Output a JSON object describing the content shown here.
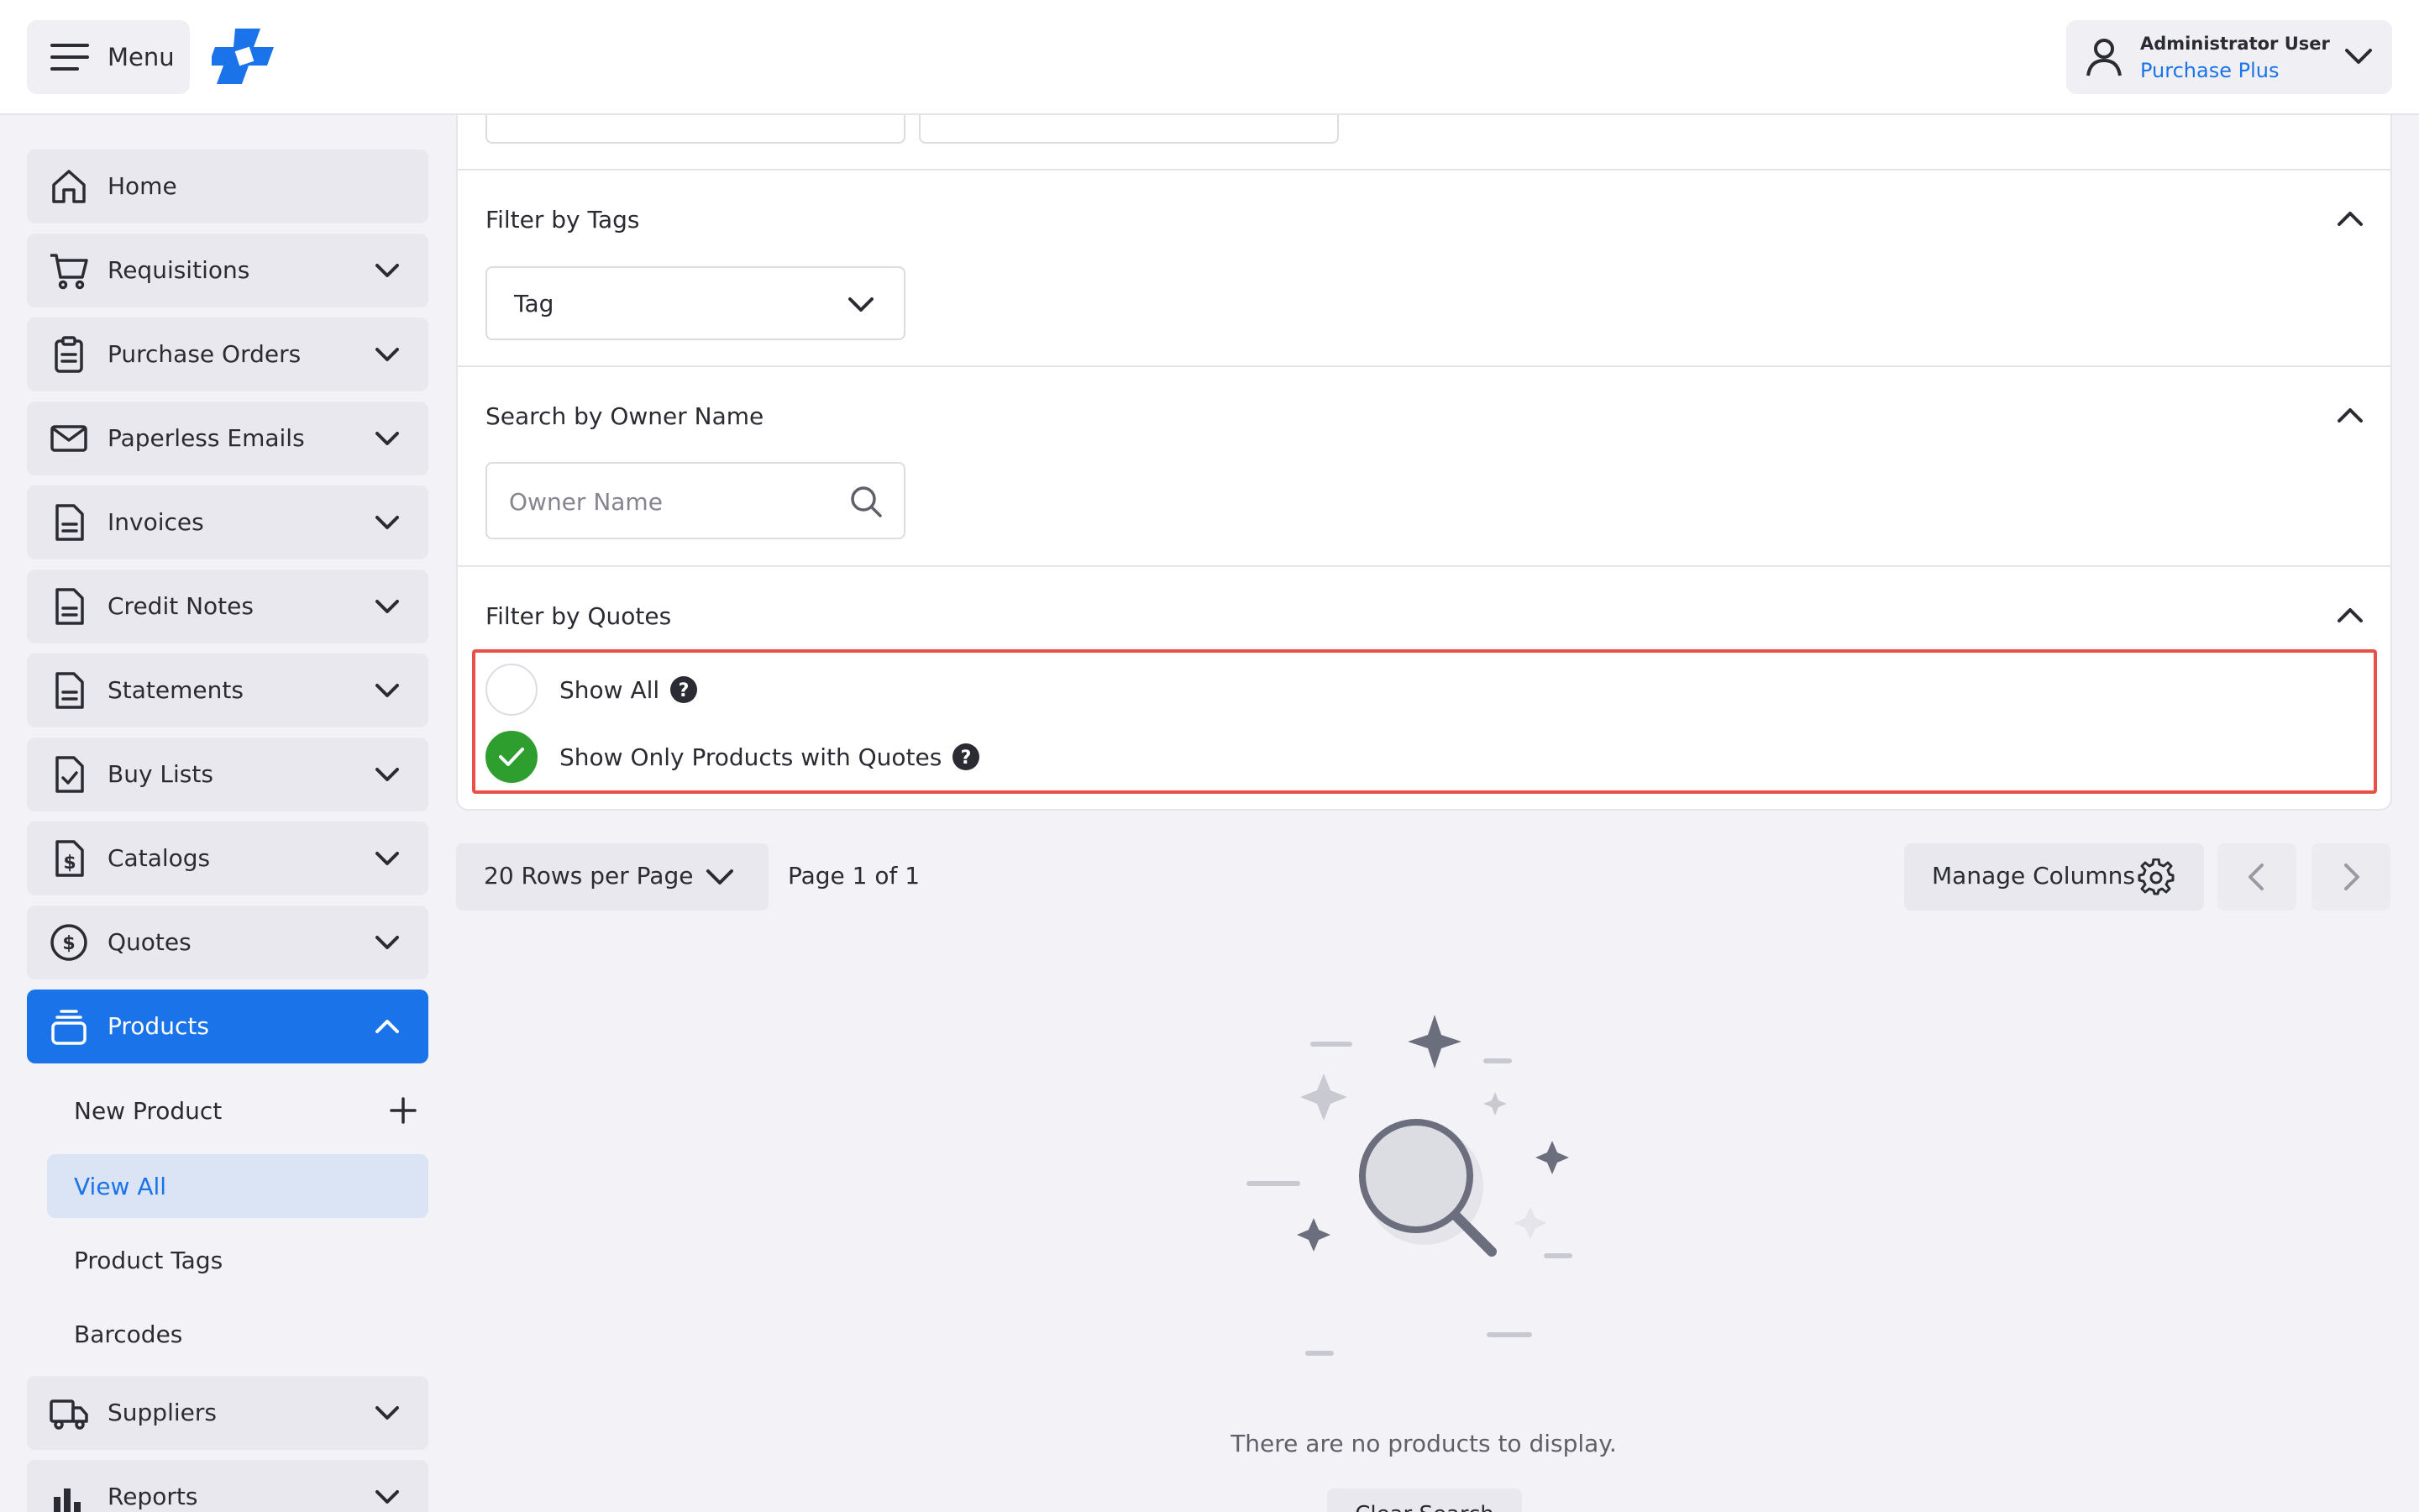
{
  "topbar": {
    "menu_label": "Menu",
    "user_name": "Administrator User",
    "organisation": "Purchase Plus"
  },
  "colors": {
    "accent": "#1a73e8",
    "highlight_border": "#e8514a",
    "check_green": "#2e9e2e"
  },
  "sidebar": {
    "items": [
      {
        "label": "Home",
        "icon": "home-icon"
      },
      {
        "label": "Requisitions",
        "icon": "cart-icon"
      },
      {
        "label": "Purchase Orders",
        "icon": "clipboard-icon"
      },
      {
        "label": "Paperless Emails",
        "icon": "envelope-icon"
      },
      {
        "label": "Invoices",
        "icon": "document-icon"
      },
      {
        "label": "Credit Notes",
        "icon": "document-icon"
      },
      {
        "label": "Statements",
        "icon": "document-icon"
      },
      {
        "label": "Buy Lists",
        "icon": "checklist-icon"
      },
      {
        "label": "Catalogs",
        "icon": "dollar-document-icon"
      },
      {
        "label": "Quotes",
        "icon": "dollar-circle-icon"
      },
      {
        "label": "Products",
        "icon": "stack-icon"
      },
      {
        "label": "Suppliers",
        "icon": "truck-icon"
      },
      {
        "label": "Reports",
        "icon": "bar-chart-icon"
      }
    ],
    "products_sub": {
      "new_product": "New Product",
      "view_all": "View All",
      "product_tags": "Product Tags",
      "barcodes": "Barcodes"
    }
  },
  "filters": {
    "tags": {
      "title": "Filter by Tags",
      "select_value": "Tag"
    },
    "owner": {
      "title": "Search by Owner Name",
      "placeholder": "Owner Name"
    },
    "quotes": {
      "title": "Filter by Quotes",
      "options": [
        {
          "label": "Show All",
          "checked": false
        },
        {
          "label": "Show Only Products with Quotes",
          "checked": true
        }
      ]
    }
  },
  "pagination": {
    "rows_per_page": "20 Rows per Page",
    "page_info": "Page 1 of 1",
    "manage_columns": "Manage Columns"
  },
  "empty_state": {
    "message": "There are no products to display.",
    "clear_button": "Clear Search"
  }
}
